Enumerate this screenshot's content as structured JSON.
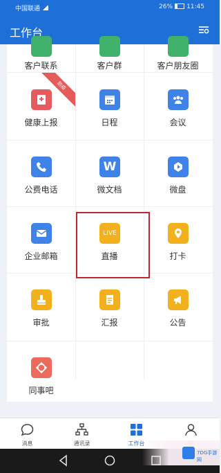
{
  "status_bar": {
    "carrier": "中国联通",
    "battery": "26%",
    "battery_fill": 0.26,
    "time": "11:45"
  },
  "header": {
    "title": "工作台",
    "settings_icon": "settings-sliders-icon"
  },
  "apps_top_row": [
    {
      "label": "客户联系",
      "color": "#3fb16b"
    },
    {
      "label": "客户群",
      "color": "#3fb16b"
    },
    {
      "label": "客户朋友圈",
      "color": "#3fb16b"
    }
  ],
  "apps": [
    {
      "label": "健康上报",
      "color": "#e65c5e",
      "icon": "health-report-icon",
      "badge": "防疫"
    },
    {
      "label": "日程",
      "color": "#3f82e8",
      "icon": "calendar-icon"
    },
    {
      "label": "会议",
      "color": "#3f82e8",
      "icon": "meeting-icon"
    },
    {
      "label": "公费电话",
      "color": "#3f82e8",
      "icon": "phone-icon"
    },
    {
      "label": "微文档",
      "color": "#3f82e8",
      "icon": "document-w-icon",
      "glyph": "W"
    },
    {
      "label": "微盘",
      "color": "#3f82e8",
      "icon": "drive-icon"
    },
    {
      "label": "企业邮箱",
      "color": "#3f82e8",
      "icon": "mail-icon"
    },
    {
      "label": "直播",
      "color": "#f2b01c",
      "icon": "live-icon",
      "glyph": "LIVE"
    },
    {
      "label": "打卡",
      "color": "#f2b01c",
      "icon": "location-pin-icon"
    },
    {
      "label": "审批",
      "color": "#f2b01c",
      "icon": "approval-stamp-icon"
    },
    {
      "label": "汇报",
      "color": "#f2b01c",
      "icon": "report-icon"
    },
    {
      "label": "公告",
      "color": "#f2b01c",
      "icon": "announcement-icon"
    },
    {
      "label": "同事吧",
      "color": "#ec6b5a",
      "icon": "colleague-community-icon"
    }
  ],
  "tabs": [
    {
      "label": "消息",
      "icon": "chat-bubble-icon"
    },
    {
      "label": "通讯录",
      "icon": "org-chart-icon"
    },
    {
      "label": "工作台",
      "icon": "grid-icon",
      "active": true
    },
    {
      "label": "我",
      "icon": "person-icon"
    }
  ],
  "nav": {
    "back": "back-triangle-icon",
    "home": "home-circle-icon",
    "recent": "recent-square-icon"
  },
  "watermark": {
    "text": "7DG手游网"
  }
}
